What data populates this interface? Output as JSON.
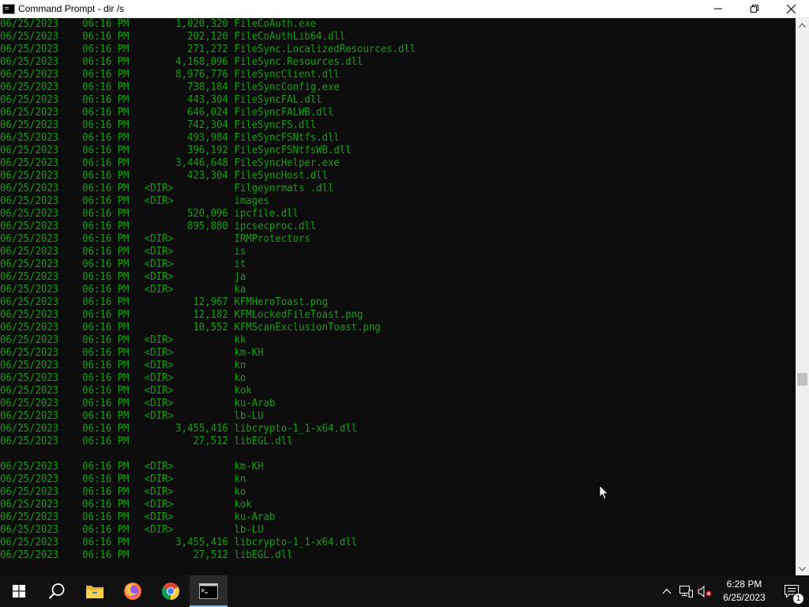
{
  "window": {
    "title": "Command Prompt - dir /s",
    "icon": "cmd-icon",
    "controls": [
      "minimize-icon",
      "restore-icon",
      "close-icon"
    ]
  },
  "console": {
    "text_color": "#13a10e",
    "background": "#0c0c0c",
    "lines": [
      {
        "date": "06/25/2023",
        "time": "06:16 PM",
        "dir": "",
        "size": "1,020,320",
        "name": "FileCoAuth.exe"
      },
      {
        "date": "06/25/2023",
        "time": "06:16 PM",
        "dir": "",
        "size": "202,120",
        "name": "FileCoAuthLib64.dll"
      },
      {
        "date": "06/25/2023",
        "time": "06:16 PM",
        "dir": "",
        "size": "271,272",
        "name": "FileSync.LocalizedResources.dll"
      },
      {
        "date": "06/25/2023",
        "time": "06:16 PM",
        "dir": "",
        "size": "4,168,096",
        "name": "FileSync.Resources.dll"
      },
      {
        "date": "06/25/2023",
        "time": "06:16 PM",
        "dir": "",
        "size": "8,976,776",
        "name": "FileSyncClient.dll"
      },
      {
        "date": "06/25/2023",
        "time": "06:16 PM",
        "dir": "",
        "size": "738,184",
        "name": "FileSyncConfig.exe"
      },
      {
        "date": "06/25/2023",
        "time": "06:16 PM",
        "dir": "",
        "size": "443,304",
        "name": "FileSyncFAL.dll"
      },
      {
        "date": "06/25/2023",
        "time": "06:16 PM",
        "dir": "",
        "size": "646,024",
        "name": "FileSyncFALWB.dll"
      },
      {
        "date": "06/25/2023",
        "time": "06:16 PM",
        "dir": "",
        "size": "742,304",
        "name": "FileSyncFS.dll"
      },
      {
        "date": "06/25/2023",
        "time": "06:16 PM",
        "dir": "",
        "size": "493,984",
        "name": "FileSyncFSNtfs.dll"
      },
      {
        "date": "06/25/2023",
        "time": "06:16 PM",
        "dir": "",
        "size": "396,192",
        "name": "FileSyncFSNtfsWB.dll"
      },
      {
        "date": "06/25/2023",
        "time": "06:16 PM",
        "dir": "",
        "size": "3,446,648",
        "name": "FileSyncHelper.exe"
      },
      {
        "date": "06/25/2023",
        "time": "06:16 PM",
        "dir": "",
        "size": "423,304",
        "name": "FileSyncHost.dll"
      },
      {
        "date": "06/25/2023",
        "time": "06:16 PM",
        "dir": "<DIR>",
        "size": "",
        "name": "Filgeynrmats .dll"
      },
      {
        "date": "06/25/2023",
        "time": "06:16 PM",
        "dir": "<DIR>",
        "size": "",
        "name": "images"
      },
      {
        "date": "06/25/2023",
        "time": "06:16 PM",
        "dir": "",
        "size": "520,096",
        "name": "ipcfile.dll"
      },
      {
        "date": "06/25/2023",
        "time": "06:16 PM",
        "dir": "",
        "size": "895,880",
        "name": "ipcsecproc.dll"
      },
      {
        "date": "06/25/2023",
        "time": "06:16 PM",
        "dir": "<DIR>",
        "size": "",
        "name": "IRMProtectors"
      },
      {
        "date": "06/25/2023",
        "time": "06:16 PM",
        "dir": "<DIR>",
        "size": "",
        "name": "is"
      },
      {
        "date": "06/25/2023",
        "time": "06:16 PM",
        "dir": "<DIR>",
        "size": "",
        "name": "it"
      },
      {
        "date": "06/25/2023",
        "time": "06:16 PM",
        "dir": "<DIR>",
        "size": "",
        "name": "ja"
      },
      {
        "date": "06/25/2023",
        "time": "06:16 PM",
        "dir": "<DIR>",
        "size": "",
        "name": "ka"
      },
      {
        "date": "06/25/2023",
        "time": "06:16 PM",
        "dir": "",
        "size": "12,967",
        "name": "KFMHeroToast.png"
      },
      {
        "date": "06/25/2023",
        "time": "06:16 PM",
        "dir": "",
        "size": "12,182",
        "name": "KFMLockedFileToast.png"
      },
      {
        "date": "06/25/2023",
        "time": "06:16 PM",
        "dir": "",
        "size": "10,552",
        "name": "KFMScanExclusionToast.png"
      },
      {
        "date": "06/25/2023",
        "time": "06:16 PM",
        "dir": "<DIR>",
        "size": "",
        "name": "kk"
      },
      {
        "date": "06/25/2023",
        "time": "06:16 PM",
        "dir": "<DIR>",
        "size": "",
        "name": "km-KH"
      },
      {
        "date": "06/25/2023",
        "time": "06:16 PM",
        "dir": "<DIR>",
        "size": "",
        "name": "kn"
      },
      {
        "date": "06/25/2023",
        "time": "06:16 PM",
        "dir": "<DIR>",
        "size": "",
        "name": "ko"
      },
      {
        "date": "06/25/2023",
        "time": "06:16 PM",
        "dir": "<DIR>",
        "size": "",
        "name": "kok"
      },
      {
        "date": "06/25/2023",
        "time": "06:16 PM",
        "dir": "<DIR>",
        "size": "",
        "name": "ku-Arab"
      },
      {
        "date": "06/25/2023",
        "time": "06:16 PM",
        "dir": "<DIR>",
        "size": "",
        "name": "lb-LU"
      },
      {
        "date": "06/25/2023",
        "time": "06:16 PM",
        "dir": "",
        "size": "3,455,416",
        "name": "libcrypto-1_1-x64.dll"
      },
      {
        "date": "06/25/2023",
        "time": "06:16 PM",
        "dir": "",
        "size": "27,512",
        "name": "libEGL.dll"
      },
      {
        "blank": true
      },
      {
        "date": "06/25/2023",
        "time": "06:16 PM",
        "dir": "<DIR>",
        "size": "",
        "name": "km-KH"
      },
      {
        "date": "06/25/2023",
        "time": "06:16 PM",
        "dir": "<DIR>",
        "size": "",
        "name": "kn"
      },
      {
        "date": "06/25/2023",
        "time": "06:16 PM",
        "dir": "<DIR>",
        "size": "",
        "name": "ko"
      },
      {
        "date": "06/25/2023",
        "time": "06:16 PM",
        "dir": "<DIR>",
        "size": "",
        "name": "kok"
      },
      {
        "date": "06/25/2023",
        "time": "06:16 PM",
        "dir": "<DIR>",
        "size": "",
        "name": "ku-Arab"
      },
      {
        "date": "06/25/2023",
        "time": "06:16 PM",
        "dir": "<DIR>",
        "size": "",
        "name": "lb-LU"
      },
      {
        "date": "06/25/2023",
        "time": "06:16 PM",
        "dir": "",
        "size": "3,455,416",
        "name": "libcrypto-1_1-x64.dll"
      },
      {
        "date": "06/25/2023",
        "time": "06:16 PM",
        "dir": "",
        "size": "27,512",
        "name": "libEGL.dll"
      }
    ]
  },
  "scrollbar": {
    "position": 0.66
  },
  "taskbar": {
    "apps": [
      {
        "icon": "windows-start-icon"
      },
      {
        "icon": "search-icon"
      },
      {
        "icon": "file-explorer-icon"
      },
      {
        "icon": "firefox-icon"
      },
      {
        "icon": "chrome-icon"
      },
      {
        "icon": "command-prompt-icon",
        "active": true
      }
    ],
    "tray_icons": [
      "chevron-up-icon",
      "network-icon",
      "volume-muted-icon"
    ],
    "clock_time": "6:28 PM",
    "clock_date": "6/25/2023",
    "notification_count": "1",
    "accent": "#76b9ed"
  }
}
